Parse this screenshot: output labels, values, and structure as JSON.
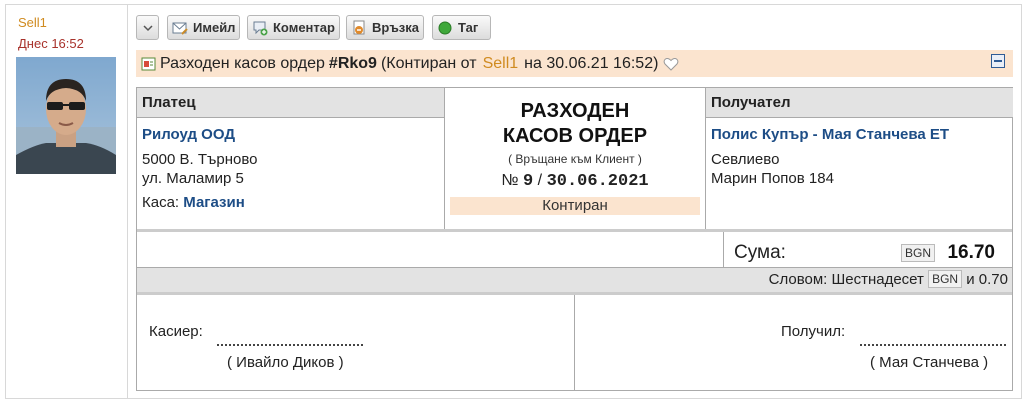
{
  "sidebar": {
    "username": "Sell1",
    "date": "Днес 16:52"
  },
  "toolbar": {
    "email_label": "Имейл",
    "comment_label": "Коментар",
    "link_label": "Връзка",
    "tag_label": "Таг"
  },
  "header": {
    "doc_type": "Разходен касов ордер",
    "doc_number": "#Rko9",
    "status_prefix": "(Контиран от",
    "user": "Sell1",
    "date_text": "на 30.06.21 16:52)"
  },
  "payer": {
    "heading": "Платец",
    "name": "Рилоуд ООД",
    "address1": "5000 В. Търново",
    "address2": "ул. Маламир 5",
    "cash_label": "Каса:",
    "cash_value": "Магазин"
  },
  "center": {
    "title_line1": "РАЗХОДЕН",
    "title_line2": "КАСОВ ОРДЕР",
    "subtitle": "( Връщане към Клиент )",
    "no_label": "№",
    "number": "9",
    "separator": "/",
    "date": "30.06.2021",
    "status": "Контиран"
  },
  "recipient": {
    "heading": "Получател",
    "name": "Полис Купър - Мая Станчева ЕТ",
    "address1": "Севлиево",
    "address2": "Марин Попов 184"
  },
  "amount": {
    "label": "Сума:",
    "currency": "BGN",
    "value": "16.70"
  },
  "words": {
    "prefix": "Словом: Шестнадесет",
    "currency": "BGN",
    "suffix": "и 0.70"
  },
  "signatures": {
    "cashier_label": "Касиер:",
    "cashier_name": "( Ивайло Диков )",
    "receiver_label": "Получил:",
    "receiver_name": "( Мая Станчева )"
  },
  "colors": {
    "accent_orange": "#d08b20",
    "date_red": "#a8322b",
    "link_blue": "#1d4d86",
    "highlight": "#fbe4cf"
  }
}
